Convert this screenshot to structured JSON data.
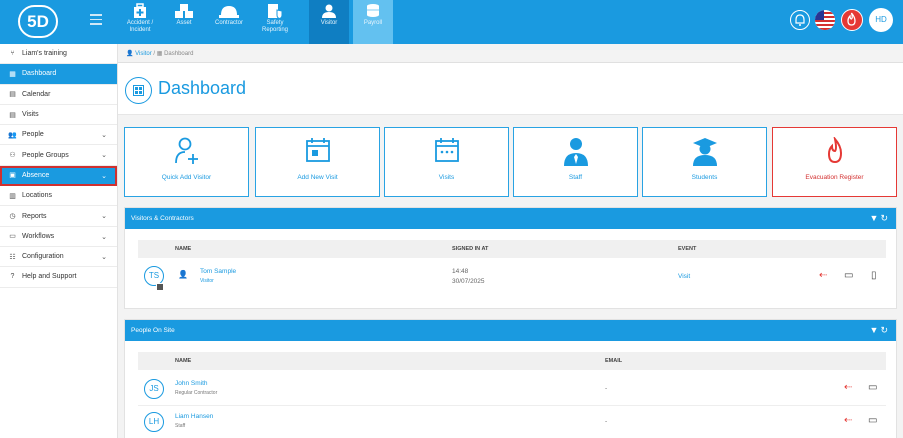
{
  "logo": {
    "text": "5D"
  },
  "modules": [
    {
      "label": "Accident / Incident",
      "icon": "first-aid-kit-icon"
    },
    {
      "label": "Asset",
      "icon": "boxes-icon"
    },
    {
      "label": "Contractor",
      "icon": "hardhat-icon"
    },
    {
      "label": "Safety Reporting",
      "icon": "document-shield-icon"
    },
    {
      "label": "Visitor",
      "icon": "person-icon"
    },
    {
      "label": "Payroll",
      "icon": "coins-icon"
    }
  ],
  "sidebar": {
    "items": [
      {
        "label": "Liam's training",
        "icon": "branch-icon"
      },
      {
        "label": "Dashboard",
        "icon": "dashboard-icon"
      },
      {
        "label": "Calendar",
        "icon": "calendar-icon"
      },
      {
        "label": "Visits",
        "icon": "calendar-icon"
      },
      {
        "label": "People",
        "icon": "people-icon"
      },
      {
        "label": "People Groups",
        "icon": "people-groups-icon"
      },
      {
        "label": "Absence",
        "icon": "absence-calendar-icon"
      },
      {
        "label": "Locations",
        "icon": "building-icon"
      },
      {
        "label": "Reports",
        "icon": "clock-icon"
      },
      {
        "label": "Workflows",
        "icon": "workflow-icon"
      },
      {
        "label": "Configuration",
        "icon": "settings-icon"
      },
      {
        "label": "Help and Support",
        "icon": "help-icon"
      }
    ]
  },
  "breadcrumb": {
    "root": "Visitor",
    "sep": "/",
    "current": "Dashboard"
  },
  "page": {
    "title": "Dashboard"
  },
  "tiles": [
    {
      "label": "Quick Add Visitor"
    },
    {
      "label": "Add New Visit"
    },
    {
      "label": "Visits"
    },
    {
      "label": "Staff"
    },
    {
      "label": "Students"
    },
    {
      "label": "Evacuation Register"
    }
  ],
  "visitors_panel": {
    "title": "Visitors & Contractors",
    "columns": {
      "name": "NAME",
      "signed_in": "SIGNED IN AT",
      "event": "EVENT"
    },
    "rows": [
      {
        "initials": "TS",
        "name": "Tom Sample",
        "type": "Visitor",
        "time": "14:48",
        "date": "30/07/2025",
        "event": "Visit"
      }
    ]
  },
  "onsite_panel": {
    "title": "People On Site",
    "columns": {
      "name": "NAME",
      "email": "EMAIL"
    },
    "rows": [
      {
        "initials": "JS",
        "name": "John Smith",
        "type": "Regular Contractor",
        "email": "-"
      },
      {
        "initials": "LH",
        "name": "Liam Hansen",
        "type": "Staff",
        "email": "-"
      }
    ]
  },
  "header_right": {
    "user_initials": "HD"
  },
  "colors": {
    "primary": "#1a9ae0",
    "danger": "#e53935"
  }
}
